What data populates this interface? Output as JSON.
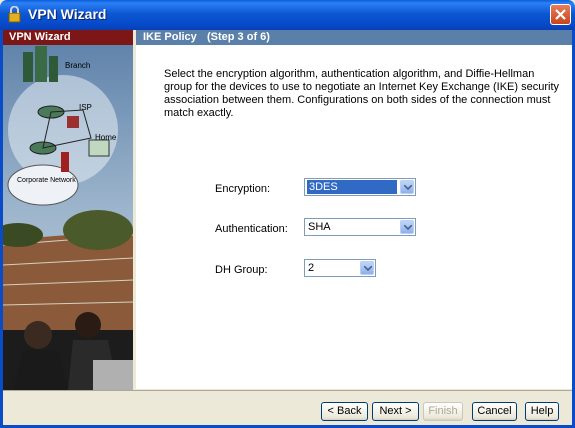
{
  "window": {
    "title": "VPN Wizard"
  },
  "left": {
    "header": "VPN Wizard"
  },
  "illustration": {
    "labels": [
      "Branch",
      "ISP",
      "Home",
      "Corporate Network"
    ]
  },
  "step": {
    "title": "IKE Policy",
    "step_text": "(Step 3 of 6)"
  },
  "description": "Select the encryption algorithm, authentication algorithm, and Diffie-Hellman group for the devices to use to negotiate an Internet Key Exchange (IKE) security association between them. Configurations on both sides of the connection must match exactly.",
  "form": {
    "encryption": {
      "label": "Encryption:",
      "value": "3DES"
    },
    "authentication": {
      "label": "Authentication:",
      "value": "SHA"
    },
    "dh_group": {
      "label": "DH Group:",
      "value": "2"
    }
  },
  "buttons": {
    "back": "< Back",
    "next": "Next >",
    "finish": "Finish",
    "cancel": "Cancel",
    "help": "Help"
  }
}
